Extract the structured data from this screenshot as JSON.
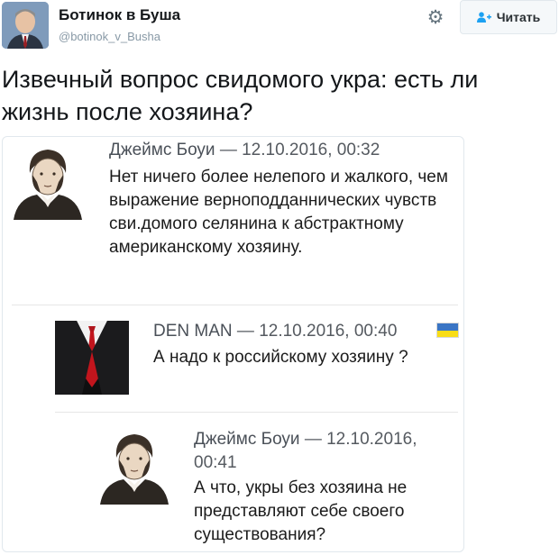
{
  "tweet": {
    "author_name": "Ботинок в Буша",
    "author_handle": "@botinok_v_Busha",
    "follow_label": "Читать",
    "text": "Извечный вопрос свидомого укра: есть ли жизнь после хозяина?"
  },
  "comments": [
    {
      "author": "Джеймс Боуи",
      "separator": "—",
      "timestamp": "12.10.2016, 00:32",
      "text": "Нет ничего более нелепого и жалкого, чем выражение верноподданнических чувств сви.домого селянина к абстрактному американскому хозяину."
    },
    {
      "author": "DEN MAN",
      "separator": "—",
      "timestamp": "12.10.2016, 00:40",
      "text": "А надо к российскому хозяину ?",
      "flag_colors": [
        "#3a75c4",
        "#f9dd16"
      ]
    },
    {
      "author": "Джеймс Боуи",
      "separator": "—",
      "timestamp_line1": "12.10.2016,",
      "timestamp_line2": "00:41",
      "text": "А что, укры без хозяина не представляют себе своего существования?"
    }
  ],
  "colors": {
    "name": "#14171a",
    "handle": "#8899a6",
    "follow_icon": "#1da1f2",
    "card_border": "#e1e8ed"
  }
}
